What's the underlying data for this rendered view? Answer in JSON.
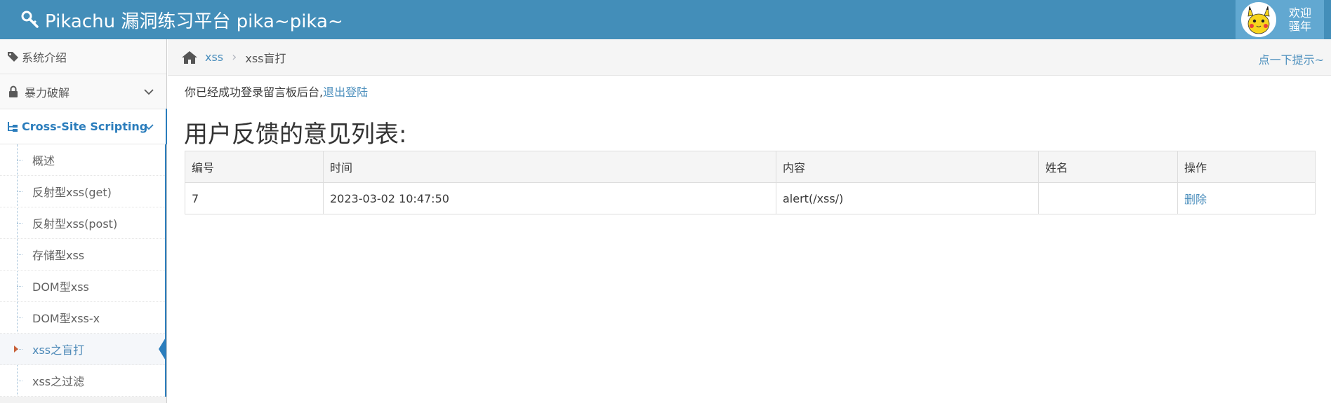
{
  "header": {
    "brand": "Pikachu 漏洞练习平台 pika~pika~",
    "user_line1": "欢迎",
    "user_line2": "骚年"
  },
  "sidebar": {
    "items": [
      {
        "label": "系统介绍",
        "icon": "tags-icon"
      },
      {
        "label": "暴力破解",
        "icon": "lock-icon"
      },
      {
        "label": "Cross-Site Scripting",
        "icon": "sitemap-icon"
      }
    ],
    "submenu": [
      {
        "label": "概述"
      },
      {
        "label": "反射型xss(get)"
      },
      {
        "label": "反射型xss(post)"
      },
      {
        "label": "存储型xss"
      },
      {
        "label": "DOM型xss"
      },
      {
        "label": "DOM型xss-x"
      },
      {
        "label": "xss之盲打"
      },
      {
        "label": "xss之过滤"
      }
    ],
    "active_sub": "xss之盲打"
  },
  "breadcrumb": {
    "link": "xss",
    "current": "xss盲打",
    "hint": "点一下提示~"
  },
  "main": {
    "login_msg": "你已经成功登录留言板后台,",
    "logout_link": "退出登陆",
    "title": "用户反馈的意见列表:",
    "table": {
      "headers": [
        "编号",
        "时间",
        "内容",
        "姓名",
        "操作"
      ],
      "rows": [
        {
          "id": "7",
          "time": "2023-03-02 10:47:50",
          "content": "alert(/xss/)",
          "name": "",
          "action": "删除"
        }
      ]
    }
  },
  "colors": {
    "navbar": "#438eb9",
    "accent": "#2b7dbc",
    "link": "#4c8fbd"
  }
}
